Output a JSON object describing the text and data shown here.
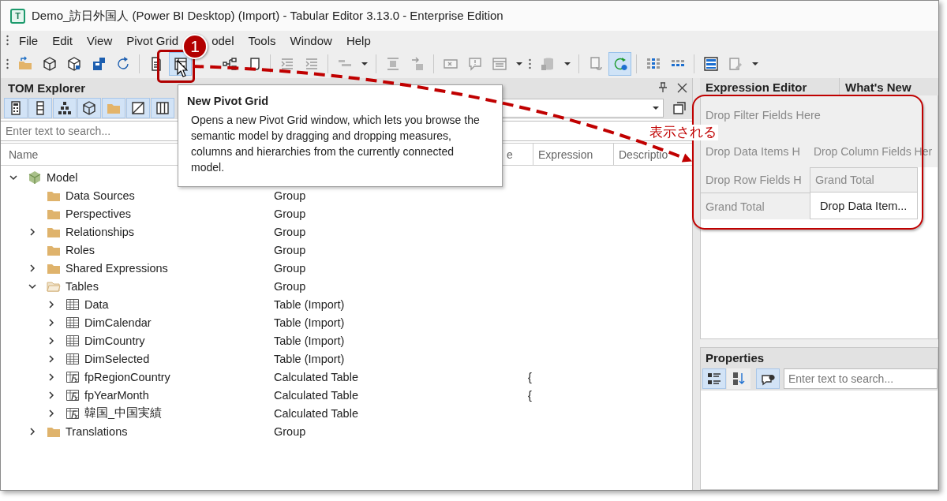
{
  "window": {
    "icon_letter": "T",
    "title": "Demo_訪日外国人 (Power BI Desktop) (Import) - Tabular Editor 3.13.0 - Enterprise Edition"
  },
  "menu": [
    "File",
    "Edit",
    "View",
    "Pivot Grid",
    "odel",
    "Tools",
    "Window",
    "Help"
  ],
  "toolbar": [
    {
      "pressed": false,
      "disabled": false
    },
    {
      "pressed": false,
      "disabled": false
    },
    {
      "pressed": false,
      "disabled": false
    },
    {
      "pressed": false,
      "disabled": false
    },
    {
      "pressed": false,
      "disabled": false
    },
    {
      "pressed": false,
      "disabled": false
    },
    {
      "pressed": true,
      "disabled": false
    },
    {
      "pressed": false,
      "disabled": false
    },
    {
      "pressed": false,
      "disabled": false
    },
    {
      "pressed": false,
      "disabled": true
    },
    {
      "pressed": false,
      "disabled": true
    },
    {
      "pressed": false,
      "disabled": true
    },
    {
      "pressed": false,
      "disabled": false
    },
    {
      "pressed": false,
      "disabled": true
    },
    {
      "pressed": false,
      "disabled": true
    },
    {
      "pressed": false,
      "disabled": true
    },
    {
      "pressed": false,
      "disabled": true
    },
    {
      "pressed": false,
      "disabled": true
    },
    {
      "pressed": false,
      "disabled": false
    },
    {
      "pressed": false,
      "disabled": true
    },
    {
      "pressed": false,
      "disabled": false
    },
    {
      "pressed": false,
      "disabled": true
    },
    {
      "pressed": true,
      "disabled": false
    },
    {
      "pressed": false,
      "disabled": false
    },
    {
      "pressed": false,
      "disabled": false
    },
    {
      "pressed": false,
      "disabled": false
    },
    {
      "pressed": false,
      "disabled": true
    },
    {
      "pressed": false,
      "disabled": false
    }
  ],
  "tom_explorer": {
    "title": "TOM Explorer",
    "toolbar": [
      {
        "pressed": true
      },
      {
        "pressed": true
      },
      {
        "pressed": true
      },
      {
        "pressed": true
      },
      {
        "pressed": true
      },
      {
        "pressed": true
      },
      {
        "pressed": true
      }
    ],
    "search": {
      "placeholder": "Enter text to search..."
    },
    "columns": [
      "Name",
      "e",
      "Expression",
      "Descriptio"
    ]
  },
  "tree": [
    {
      "name": "Model",
      "kind": "model",
      "expanded": true,
      "children": [
        {
          "name": "Data Sources",
          "kind": "folder",
          "type": "Group"
        },
        {
          "name": "Perspectives",
          "kind": "folder",
          "type": "Group"
        },
        {
          "name": "Relationships",
          "kind": "folder",
          "type": "Group",
          "expanded": false
        },
        {
          "name": "Roles",
          "kind": "folder",
          "type": "Group"
        },
        {
          "name": "Shared Expressions",
          "kind": "folder",
          "type": "Group",
          "expanded": false
        },
        {
          "name": "Tables",
          "kind": "folder",
          "type": "Group",
          "expanded": true,
          "children": [
            {
              "name": "Data",
              "kind": "table",
              "type": "Table (Import)",
              "expanded": false
            },
            {
              "name": "DimCalendar",
              "kind": "table",
              "type": "Table (Import)",
              "expanded": false
            },
            {
              "name": "DimCountry",
              "kind": "table",
              "type": "Table (Import)",
              "expanded": false
            },
            {
              "name": "DimSelected",
              "kind": "table",
              "type": "Table (Import)",
              "expanded": false
            },
            {
              "name": "fpRegionCountry",
              "kind": "calculated-table",
              "type": "Calculated Table",
              "expression": "{",
              "expanded": false
            },
            {
              "name": "fpYearMonth",
              "kind": "calculated-table",
              "type": "Calculated Table",
              "expression": "{",
              "expanded": false
            },
            {
              "name": "韓国_中国実績",
              "kind": "calculated-table",
              "type": "Calculated Table",
              "expanded": false
            }
          ]
        },
        {
          "name": "Translations",
          "kind": "folder",
          "type": "Group",
          "expanded": false
        }
      ]
    }
  ],
  "tooltip": {
    "title": "New Pivot Grid",
    "text": "Opens a new Pivot Grid window, which lets you browse the semantic model by dragging and dropping measures, columns and hierarchies from the currently connected model."
  },
  "annotations": {
    "badge": "1",
    "label": "表示される"
  },
  "right_tabs": [
    "Expression Editor",
    "What's New"
  ],
  "pivot_grid": {
    "filter": "Drop Filter Fields Here",
    "data_items": "Drop Data Items H",
    "column_fields": "Drop Column Fields Her",
    "row_fields": "Drop Row Fields H",
    "column_total": "Grand Total",
    "row_total": "Grand Total",
    "data_cell": "Drop Data Item..."
  },
  "properties": {
    "title": "Properties",
    "toolbar": [
      {
        "pressed": true
      },
      {
        "pressed": false
      },
      {
        "pressed": true
      }
    ],
    "search": {
      "placeholder": "Enter text to search..."
    }
  }
}
